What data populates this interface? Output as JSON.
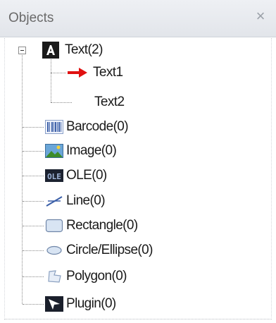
{
  "panel": {
    "title": "Objects",
    "close_glyph": "×"
  },
  "tree": {
    "text_group": {
      "label": "Text(2)",
      "icon": "text-A-icon",
      "expanded": true,
      "children": [
        {
          "label": "Text1",
          "selected_marker": "red-arrow-icon"
        },
        {
          "label": "Text2"
        }
      ]
    },
    "items": [
      {
        "label": "Barcode(0)",
        "icon": "barcode-icon"
      },
      {
        "label": "Image(0)",
        "icon": "image-icon"
      },
      {
        "label": "OLE(0)",
        "icon": "ole-icon"
      },
      {
        "label": "Line(0)",
        "icon": "line-icon"
      },
      {
        "label": "Rectangle(0)",
        "icon": "rectangle-icon"
      },
      {
        "label": "Circle/Ellipse(0)",
        "icon": "ellipse-icon"
      },
      {
        "label": "Polygon(0)",
        "icon": "polygon-icon"
      },
      {
        "label": "Plugin(0)",
        "icon": "plugin-icon"
      }
    ]
  },
  "colors": {
    "header_bg": "#e6e9ee",
    "arrow_red": "#e01010",
    "icon_dark": "#1a1a1a"
  }
}
